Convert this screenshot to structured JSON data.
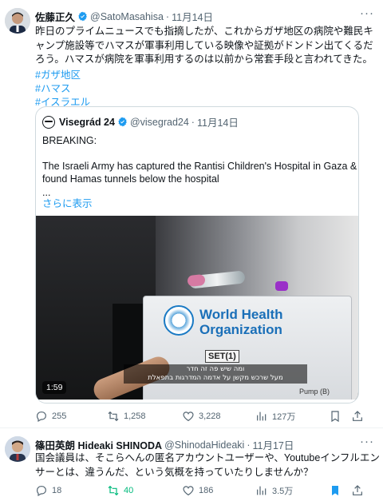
{
  "tweet1": {
    "display_name": "佐藤正久",
    "handle": "@SatoMasahisa",
    "date": "11月14日",
    "body_lines": [
      "昨日のプライムニュースでも指摘したが、これからガザ地区の病院や難民キ",
      "ャンプ施設等でハマスが軍事利用している映像や証拠がドンドン出てくるだ",
      "ろう。ハマスが病院を軍事利用するのは以前から常套手段と言われてきた。"
    ],
    "hashtags": [
      "#ガザ地区",
      "#ハマス",
      "#イスラエル"
    ],
    "quote": {
      "display_name": "Visegrád 24",
      "handle": "@visegrad24",
      "date": "11月14日",
      "line1": "BREAKING:",
      "line2": "The Israeli Army has captured the Rantisi Children's Hospital in Gaza &",
      "line3": "found Hamas tunnels below the hospital",
      "ellipsis": "...",
      "show_more": "さらに表示",
      "video": {
        "duration": "1:59",
        "logo_line1": "World Health",
        "logo_line2": "Organization",
        "set_label": "SET(1)",
        "pump_label": "Pump (B)",
        "subtitle_line1": "ומה שיש פה זה חדר",
        "subtitle_line2": "מעל שרכש מקשן על אדמה המדרגות בתפאלת"
      }
    },
    "stats": {
      "replies": "255",
      "retweets": "1,258",
      "likes": "3,228",
      "views": "127万"
    }
  },
  "tweet2": {
    "display_name": "篠田英朗 Hideaki SHINODA",
    "handle": "@ShinodaHideaki",
    "date": "11月17日",
    "body_lines": [
      "国会議員は、そこらへんの匿名アカウントユーザーや、Youtubeインフルエン",
      "サーとは、違うんだ、という気概を持っていたりしませんか？"
    ],
    "stats": {
      "replies": "18",
      "retweets": "40",
      "likes": "186",
      "views": "3.5万"
    }
  },
  "colors": {
    "accent": "#1d9bf0",
    "retweet_active": "#00ba7c",
    "muted": "#536471"
  },
  "icons": [
    "verified-badge-icon",
    "more-icon",
    "reply-icon",
    "retweet-icon",
    "like-icon",
    "views-icon",
    "bookmark-icon",
    "share-icon"
  ],
  "dot": "·",
  "more": "···"
}
